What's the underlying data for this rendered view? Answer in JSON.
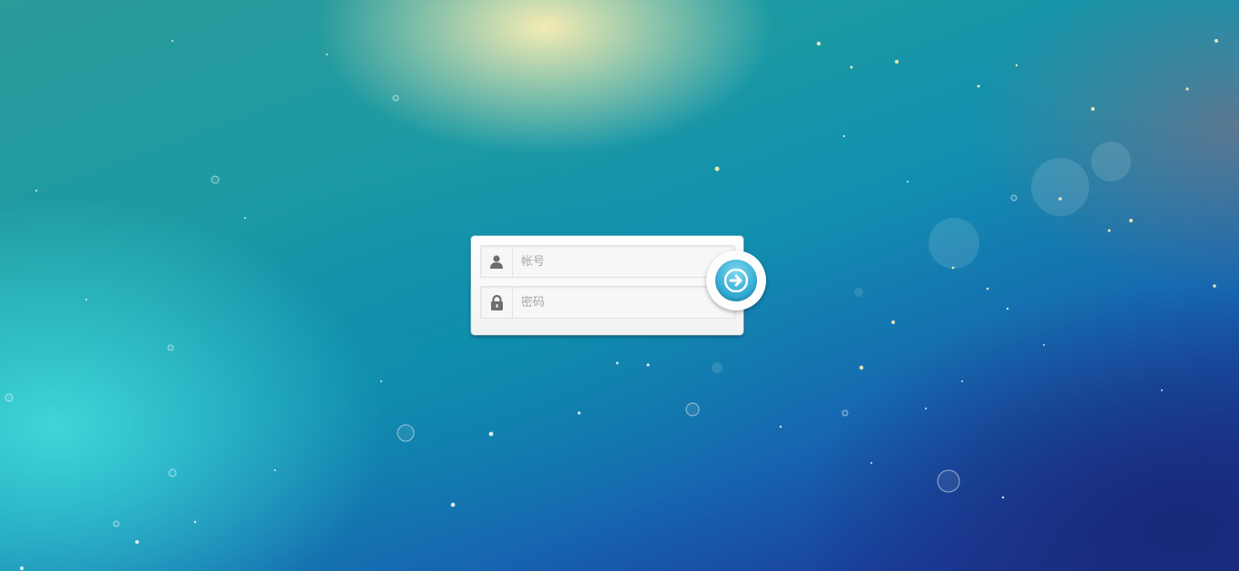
{
  "login": {
    "account_placeholder": "帐号",
    "password_placeholder": "密码",
    "account_icon": "user-icon",
    "password_icon": "lock-icon",
    "submit_icon": "arrow-right-icon"
  },
  "colors": {
    "accent": "#3ab0d8",
    "card": "#ffffff",
    "field_bg": "#f7f7f7",
    "icon": "#6e6e6e"
  }
}
